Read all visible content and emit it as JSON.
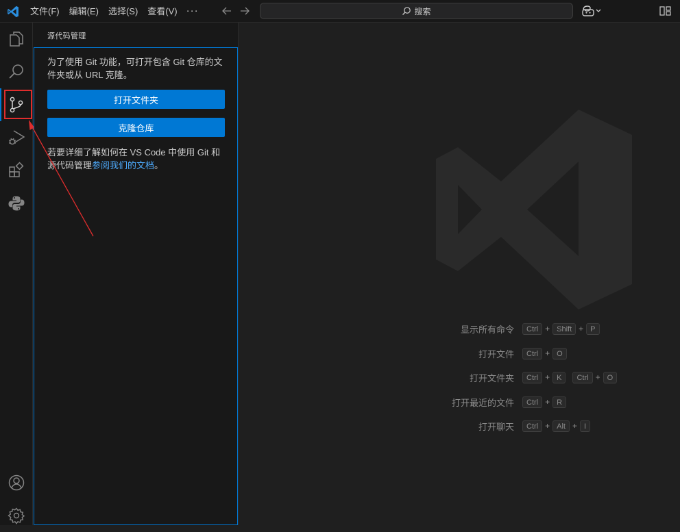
{
  "menu": {
    "items": [
      "文件(F)",
      "编辑(E)",
      "选择(S)",
      "查看(V)"
    ],
    "more": "···"
  },
  "search": {
    "label": "搜索"
  },
  "sidebar": {
    "title": "源代码管理",
    "intro": "为了使用 Git 功能，可打开包含 Git 仓库的文件夹或从 URL 克隆。",
    "open_folder_button": "打开文件夹",
    "clone_button": "克隆仓库",
    "help_prefix": "若要详细了解如何在 VS Code 中使用 Git 和源代码管理",
    "help_link": "参阅我们的文档",
    "help_suffix": "。"
  },
  "shortcuts": [
    {
      "label": "显示所有命令",
      "chords": [
        [
          "Ctrl",
          "Shift",
          "P"
        ]
      ]
    },
    {
      "label": "打开文件",
      "chords": [
        [
          "Ctrl",
          "O"
        ]
      ]
    },
    {
      "label": "打开文件夹",
      "chords": [
        [
          "Ctrl",
          "K"
        ],
        [
          "Ctrl",
          "O"
        ]
      ]
    },
    {
      "label": "打开最近的文件",
      "chords": [
        [
          "Ctrl",
          "R"
        ]
      ]
    },
    {
      "label": "打开聊天",
      "chords": [
        [
          "Ctrl",
          "Alt",
          "I"
        ]
      ]
    }
  ],
  "colors": {
    "accent": "#0078d4",
    "annotation": "#e02d2d",
    "link": "#4daafc",
    "background": "#1f1f1f",
    "sidebar_background": "#181818"
  },
  "icons": {
    "activity_bar": [
      "explorer-icon",
      "search-icon",
      "source-control-icon",
      "run-debug-icon",
      "extensions-icon",
      "python-icon"
    ],
    "activity_bar_bottom": [
      "account-icon",
      "settings-icon"
    ]
  },
  "active_view": "source-control"
}
